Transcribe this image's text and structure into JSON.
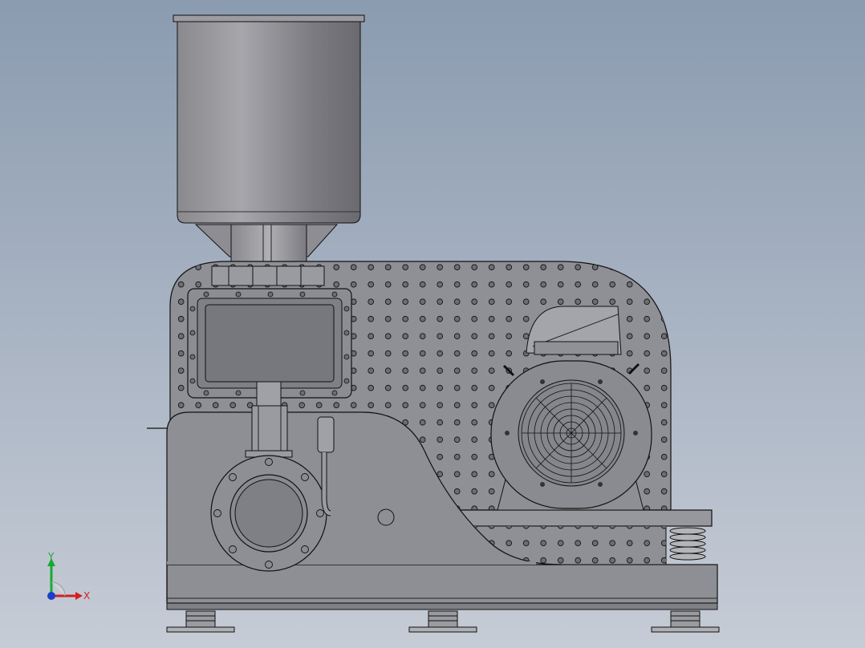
{
  "viewport": {
    "background_top": "#8b9bb0",
    "background_bottom": "#c6ccd6"
  },
  "triad": {
    "x_label": "X",
    "y_label": "Y",
    "x_color": "#d42020",
    "y_color": "#18a830",
    "z_color": "#1a3fc8"
  },
  "model": {
    "body_color": "#8e8f94",
    "edge_color": "#1a1a1a",
    "hopper_icon": "cylinder-hopper"
  }
}
